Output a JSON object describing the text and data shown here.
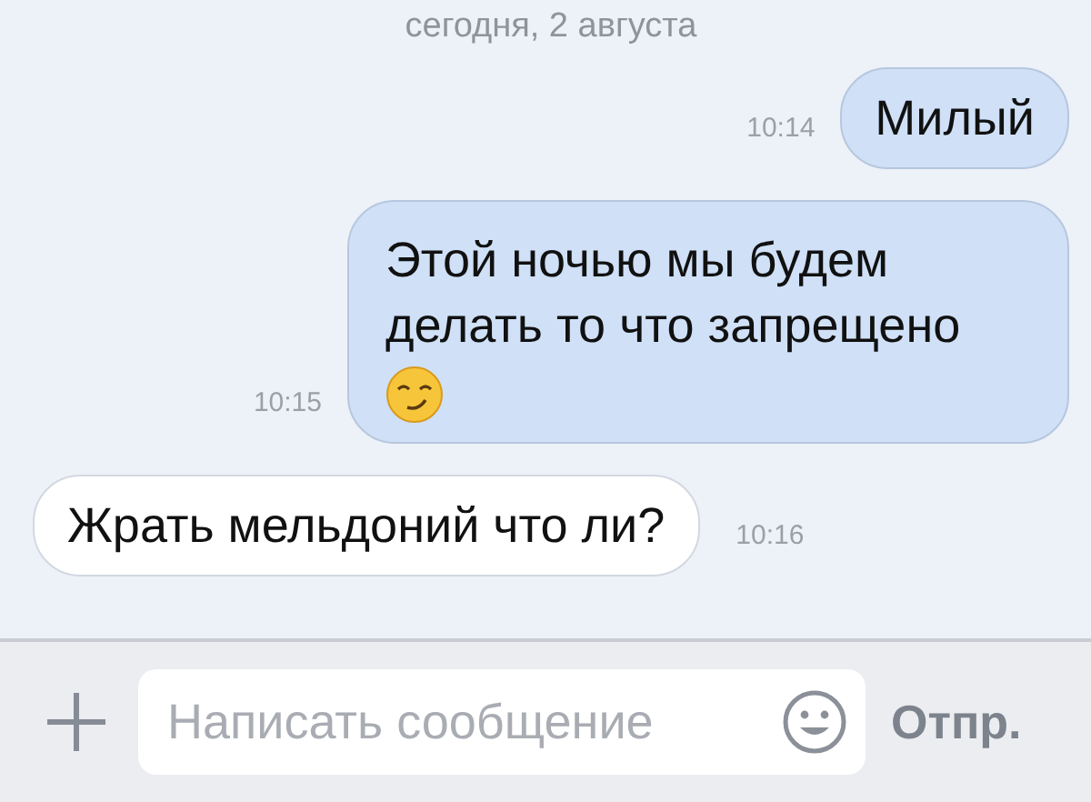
{
  "date_header": "сегодня, 2 августа",
  "messages": [
    {
      "kind": "out",
      "text": "Милый",
      "time": "10:14",
      "emoji": false
    },
    {
      "kind": "out",
      "text": "Этой ночью мы будем делать то что запрещено",
      "time": "10:15",
      "emoji": true
    },
    {
      "kind": "in",
      "text": "Жрать мельдоний что ли?",
      "time": "10:16",
      "emoji": false
    }
  ],
  "composer": {
    "placeholder": "Написать сообщение",
    "send": "Отпр."
  }
}
